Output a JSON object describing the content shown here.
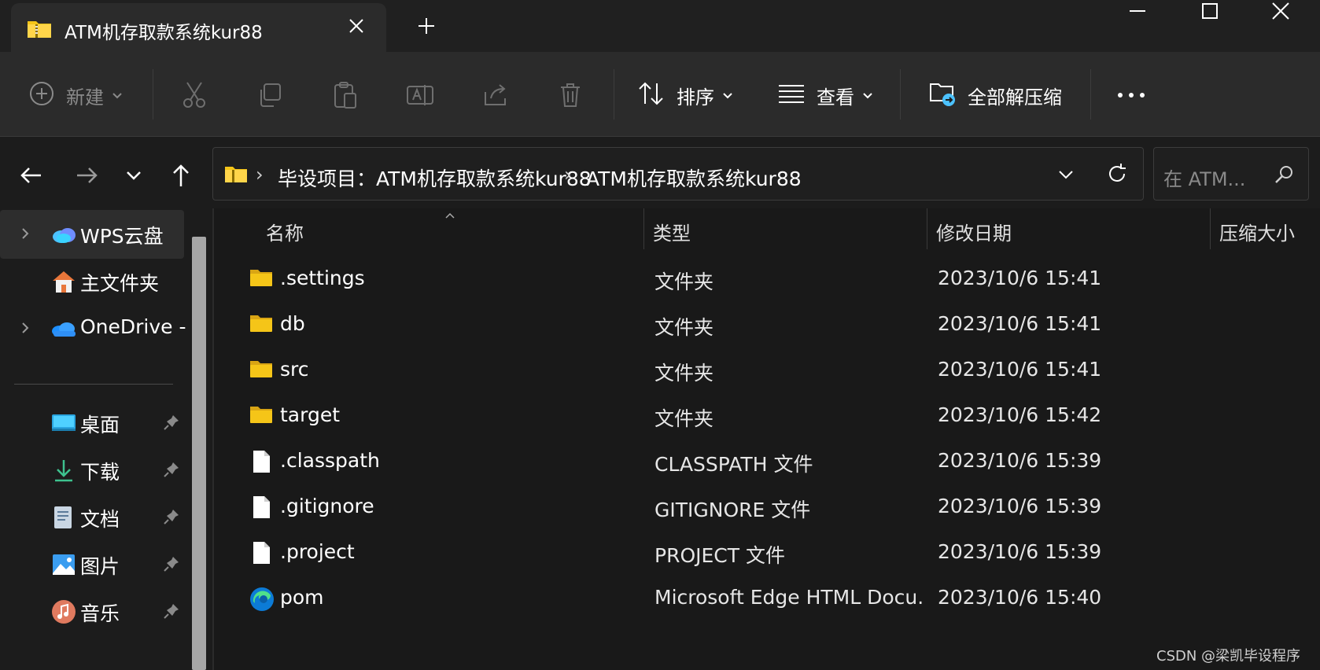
{
  "window": {
    "tab_title": "ATM机存取款系统kur88"
  },
  "toolbar": {
    "new_label": "新建",
    "sort_label": "排序",
    "view_label": "查看",
    "extract_label": "全部解压缩"
  },
  "address": {
    "crumbs": [
      "毕设项目：ATM机存取款系统kur88",
      "ATM机存取款系统kur88"
    ],
    "search_placeholder": "在 ATM..."
  },
  "sidebar": {
    "items": [
      {
        "label": "WPS云盘",
        "icon": "wps-cloud-icon",
        "expandable": true,
        "selected": true
      },
      {
        "label": "主文件夹",
        "icon": "home-icon",
        "expandable": false
      },
      {
        "label": "OneDrive -",
        "icon": "onedrive-icon",
        "expandable": true
      },
      {
        "label": "桌面",
        "icon": "desktop-icon",
        "pinned": true
      },
      {
        "label": "下载",
        "icon": "download-icon",
        "pinned": true
      },
      {
        "label": "文档",
        "icon": "document-icon",
        "pinned": true
      },
      {
        "label": "图片",
        "icon": "picture-icon",
        "pinned": true
      },
      {
        "label": "音乐",
        "icon": "music-icon",
        "pinned": true
      }
    ]
  },
  "filelist": {
    "columns": [
      "名称",
      "类型",
      "修改日期",
      "压缩大小"
    ],
    "rows": [
      {
        "name": ".settings",
        "type": "文件夹",
        "date": "2023/10/6 15:41",
        "icon": "folder-icon"
      },
      {
        "name": "db",
        "type": "文件夹",
        "date": "2023/10/6 15:41",
        "icon": "folder-icon"
      },
      {
        "name": "src",
        "type": "文件夹",
        "date": "2023/10/6 15:41",
        "icon": "folder-icon"
      },
      {
        "name": "target",
        "type": "文件夹",
        "date": "2023/10/6 15:42",
        "icon": "folder-icon"
      },
      {
        "name": ".classpath",
        "type": "CLASSPATH 文件",
        "date": "2023/10/6 15:39",
        "icon": "file-icon"
      },
      {
        "name": ".gitignore",
        "type": "GITIGNORE 文件",
        "date": "2023/10/6 15:39",
        "icon": "file-icon"
      },
      {
        "name": ".project",
        "type": "PROJECT 文件",
        "date": "2023/10/6 15:39",
        "icon": "file-icon"
      },
      {
        "name": "pom",
        "type": "Microsoft Edge HTML Docu...",
        "date": "2023/10/6 15:40",
        "icon": "edge-icon"
      }
    ]
  },
  "watermark": "CSDN @梁凯毕设程序",
  "colors": {
    "folder": "#f5c518",
    "accent": "#4cc2ff",
    "background": "#1c1c1c",
    "toolbar": "#2b2b2b"
  }
}
